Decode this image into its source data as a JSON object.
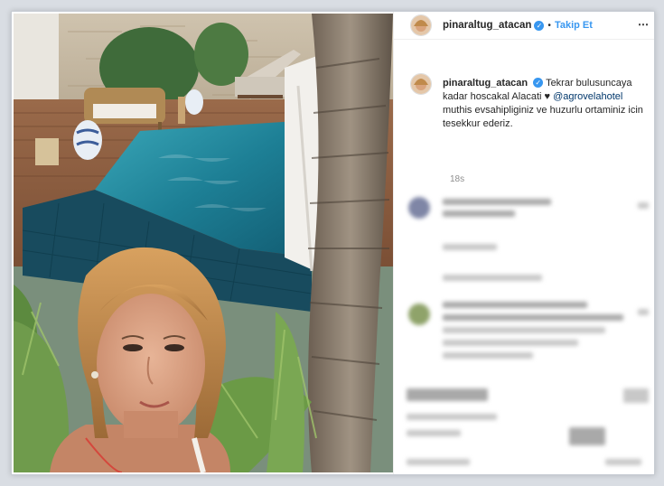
{
  "post": {
    "username": "pinaraltug_atacan",
    "verified_mark": "✓",
    "separator": "•",
    "follow_label": "Takip Et",
    "more_icon": "⋯",
    "caption_prefix": "Tekrar bulusuncaya kadar hoscakal Alacati",
    "heart": "♥",
    "mention": "@agrovelahotel",
    "caption_suffix": "muthis evsahipliginiz ve huzurlu ortaminiz icin tesekkur ederiz.",
    "time_ago": "18s"
  },
  "colors": {
    "accent": "#3897f0",
    "mention": "#00376b",
    "text": "#262626",
    "muted": "#8e8e8e"
  }
}
